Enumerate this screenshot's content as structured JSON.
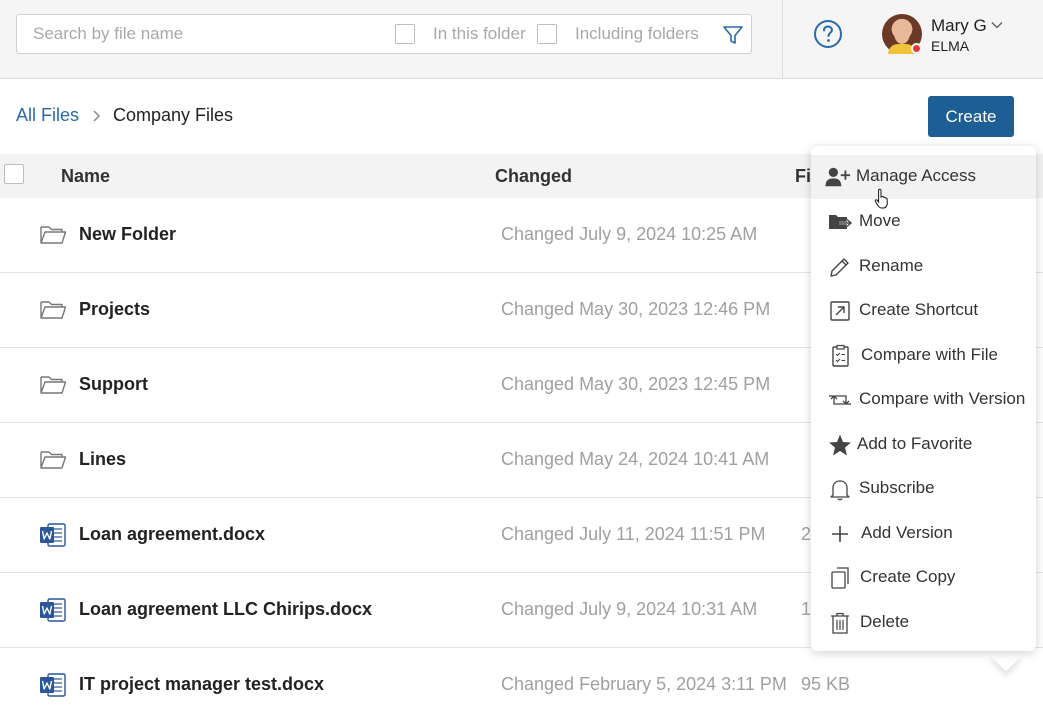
{
  "search": {
    "placeholder": "Search by file name",
    "in_this_folder_label": "In this folder",
    "including_folders_label": "Including folders"
  },
  "user": {
    "name": "Mary G",
    "company": "ELMA",
    "status_color": "#e53935"
  },
  "breadcrumb": {
    "root": "All Files",
    "current": "Company Files"
  },
  "create_button": "Create",
  "table": {
    "columns": [
      "Name",
      "Changed",
      "Fi"
    ],
    "rows": [
      {
        "icon": "folder-icon",
        "name": "New Folder",
        "changed": "Changed July 9, 2024 10:25 AM",
        "size": ""
      },
      {
        "icon": "folder-icon",
        "name": "Projects",
        "changed": "Changed May 30, 2023 12:46 PM",
        "size": ""
      },
      {
        "icon": "folder-icon",
        "name": "Support",
        "changed": "Changed May 30, 2023 12:45 PM",
        "size": ""
      },
      {
        "icon": "folder-icon",
        "name": "Lines",
        "changed": "Changed May 24, 2024 10:41 AM",
        "size": ""
      },
      {
        "icon": "word-doc-icon",
        "name": "Loan agreement.docx",
        "changed": "Changed July 11, 2024 11:51 PM",
        "size": "2"
      },
      {
        "icon": "word-doc-icon",
        "name": "Loan agreement LLC Chirips.docx",
        "changed": "Changed July 9, 2024 10:31 AM",
        "size": "1"
      },
      {
        "icon": "word-doc-icon",
        "name": "IT project manager test.docx",
        "changed": "Changed February 5, 2024 3:11 PM",
        "size": "95 KB"
      }
    ]
  },
  "context_menu": {
    "items": [
      {
        "icon": "manage-access-icon",
        "label": "Manage Access"
      },
      {
        "icon": "move-icon",
        "label": "Move"
      },
      {
        "icon": "pencil-icon",
        "label": "Rename"
      },
      {
        "icon": "shortcut-icon",
        "label": "Create Shortcut"
      },
      {
        "icon": "clipboard-icon",
        "label": "Compare with File"
      },
      {
        "icon": "compare-version-icon",
        "label": "Compare with Version"
      },
      {
        "icon": "star-icon",
        "label": "Add to Favorite"
      },
      {
        "icon": "bell-icon",
        "label": "Subscribe"
      },
      {
        "icon": "plus-icon",
        "label": "Add Version"
      },
      {
        "icon": "copy-icon",
        "label": "Create Copy"
      },
      {
        "icon": "trash-icon",
        "label": "Delete"
      }
    ]
  },
  "colors": {
    "link": "#2a6aa8",
    "primary_button": "#1d5e94",
    "word_icon": "#2b579a"
  }
}
